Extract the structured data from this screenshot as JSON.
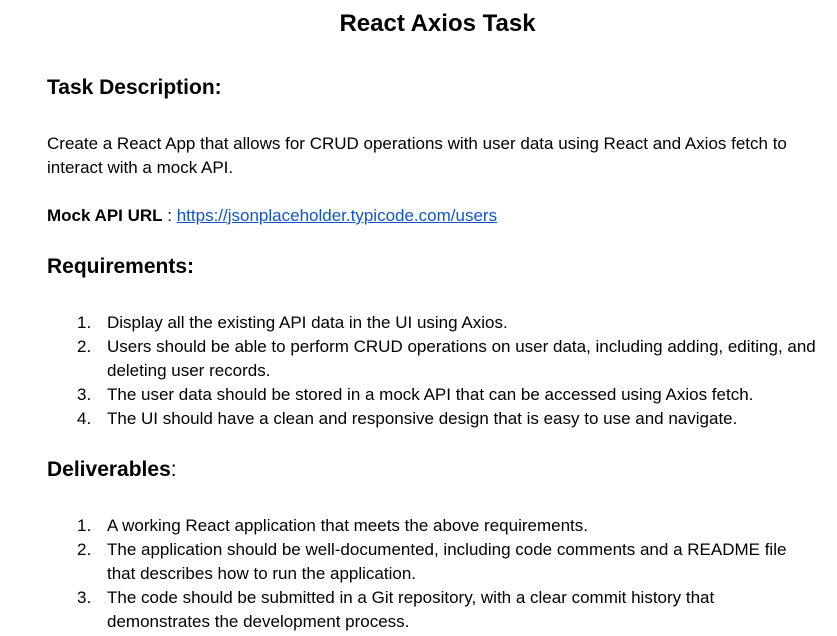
{
  "document": {
    "title": "React Axios Task",
    "task_description": {
      "heading": "Task Description:",
      "body": "Create a React App that allows for CRUD operations with user data using React and Axios fetch to interact with a mock API."
    },
    "mock_api": {
      "label": "Mock API URL",
      "separator": " : ",
      "url": "https://jsonplaceholder.typicode.com/users"
    },
    "requirements": {
      "heading": "Requirements:",
      "items": [
        {
          "num": "1.",
          "text": "Display all the existing API data in the UI using Axios."
        },
        {
          "num": "2.",
          "text": "Users should be able to perform CRUD operations on user data, including adding, editing, and deleting user records."
        },
        {
          "num": "3.",
          "text": "The user data should be stored in a mock API that can be accessed using Axios fetch."
        },
        {
          "num": "4.",
          "text": "The UI should have a clean and responsive design that is easy to use and navigate."
        }
      ]
    },
    "deliverables": {
      "heading": "Deliverables",
      "heading_suffix": ":",
      "items": [
        {
          "num": "1.",
          "text": "A working React application that meets the above requirements."
        },
        {
          "num": "2.",
          "text": "The application should be well-documented, including code comments and a README file that describes how to run the application."
        },
        {
          "num": "3.",
          "text": "The code should be submitted in a Git repository, with a clear commit history that demonstrates the development process."
        }
      ]
    },
    "colors": {
      "link": "#1155cc",
      "text": "#000000",
      "background": "#ffffff"
    }
  }
}
